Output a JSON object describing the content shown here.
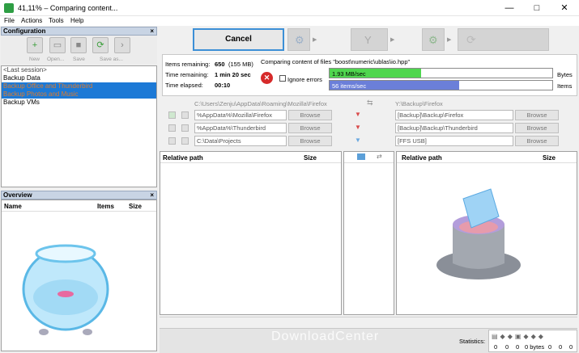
{
  "window": {
    "title": "41,11% – Comparing content...",
    "minimize": "—",
    "maximize": "□",
    "close": "✕"
  },
  "menu": [
    "File",
    "Actions",
    "Tools",
    "Help"
  ],
  "configuration": {
    "title": "Configuration",
    "tools": [
      "New",
      "Open...",
      "Save",
      "Save as..."
    ],
    "items": [
      "<Last session>",
      "Backup Data",
      "Backup Office and Thunderbird",
      "Backup Photos and Music",
      "Backup VMs"
    ]
  },
  "overview": {
    "title": "Overview",
    "columns": [
      "Name",
      "Items",
      "Size"
    ]
  },
  "toolbar": {
    "cancel": "Cancel"
  },
  "progress": {
    "items_remaining_label": "Items remaining:",
    "items_remaining_value": "650",
    "items_remaining_size": "(155 MB)",
    "time_remaining_label": "Time remaining:",
    "time_remaining_value": "1 min 20 sec",
    "time_elapsed_label": "Time elapsed:",
    "time_elapsed_value": "00:10",
    "status": "Comparing content of files \"boost\\numeric\\ublas\\io.hpp\"",
    "ignore_errors": "Ignore errors",
    "bytes_rate": "1.93 MB/sec",
    "items_rate": "56 items/sec",
    "bytes_label": "Bytes",
    "items_label": "Items",
    "bytes_fill": 0.41,
    "items_fill": 0.58
  },
  "folders": {
    "left_root": "C:\\Users\\Zenju\\AppData\\Roaming\\Mozilla\\Firefox",
    "right_root": "Y:\\Backup\\Firefox",
    "browse": "Browse",
    "pairs": [
      {
        "left": "%AppData%\\Mozilla\\Firefox",
        "right": "[Backup]\\Backup\\Firefox"
      },
      {
        "left": "%AppData%\\Thunderbird",
        "right": "[Backup]\\Backup\\Thunderbird"
      },
      {
        "left": "C:\\Data\\Projects",
        "right": "[FFS USB]"
      }
    ]
  },
  "grid": {
    "relative_path": "Relative path",
    "size": "Size"
  },
  "statusbar": {
    "statistics": "Statistics:",
    "counts": [
      "0",
      "0",
      "0",
      "0 bytes",
      "0",
      "0",
      "0"
    ]
  },
  "watermark": "DownloadCenter",
  "colors": {
    "accent": "#1c79d6",
    "bytes_bar": "#4fd64f",
    "items_bar": "#6b7fd9"
  }
}
